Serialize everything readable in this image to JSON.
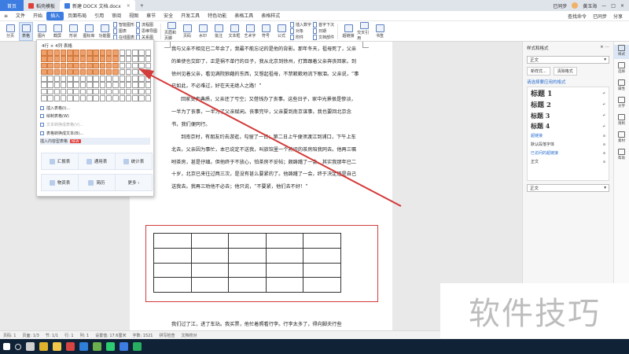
{
  "tabs": [
    {
      "label": "首页",
      "kind": "home"
    },
    {
      "label": "稻壳模板",
      "kind": "normal",
      "color": "#e0403a"
    },
    {
      "label": "新建 DOCX 文档.docx",
      "kind": "active",
      "color": "#3d7ce0"
    }
  ],
  "titlebar_right": {
    "login": "已同步",
    "user": "黄玉海"
  },
  "menu": [
    "文件",
    "开始",
    "插入",
    "页面布局",
    "引用",
    "审阅",
    "视图",
    "章节",
    "安全",
    "开发工具",
    "特色功能",
    "表格工具",
    "表格样式"
  ],
  "menu_active_index": 2,
  "menu_right": [
    "查找命令",
    "已同步",
    "分享"
  ],
  "ribbon": {
    "buttons": [
      "分页",
      "表格",
      "图片",
      "截屏",
      "形状",
      "图标库",
      "功能图"
    ],
    "col1": [
      "智能图形",
      "图表",
      "在线图表"
    ],
    "col2": [
      "流程图",
      "思维导图",
      "关系图"
    ],
    "buttons2": [
      "页眉和页脚",
      "页码",
      "水印",
      "批注",
      "文本框",
      "艺术字",
      "符号",
      "公式"
    ],
    "col3": [
      "插入数字",
      "对象",
      "附件"
    ],
    "col4": [
      "首字下沉",
      "日期",
      "文档部件"
    ],
    "buttons3": [
      "超链接",
      "交叉引用",
      "书签"
    ]
  },
  "dropdown": {
    "grid_label": "4行 × 4列 表格",
    "grid_rows": 8,
    "grid_cols": 17,
    "selected_rows": 4,
    "selected_cols": 12,
    "items": [
      {
        "label": "插入表格(I)...",
        "disabled": false
      },
      {
        "label": "绘制表格(W)",
        "disabled": false
      },
      {
        "label": "文本转换成表格(V)...",
        "disabled": true
      },
      {
        "label": "表格转换成文本(B)...",
        "disabled": false
      },
      {
        "label": "插入内容型表格",
        "disabled": false,
        "badge": "NEW"
      }
    ],
    "templates": [
      "汇报表",
      "通用表",
      "统计表",
      "物资表",
      "简历",
      "更多"
    ]
  },
  "document": {
    "paragraphs": [
      "我与父亲不相见已二年余了，我最不能忘记的是他的背影。那年冬天，祖母死了，父亲的差使也交卸了，正是祸不单行的日子，我从北京到徐州，打算跟着父亲奔丧回家。到徐州见着父亲，看见满院狼藉的东西，又想起祖母，不禁簌簌地流下眼泪。父亲说，“事已如此，不必难过，好在天无绝人之路！”",
      "回家变卖典质，父亲还了亏空；又借钱办了丧事。这些日子，家中光景很是惨淡，一半为了丧事，一半为了父亲赋闲。丧事完毕，父亲要到南京谋事，我也要回北京念书，我们便同行。",
      "到南京时，有朋友约去游逛，勾留了一日；第二日上午便须渡江到浦口，下午上车北去。父亲因为事忙，本已说定不送我，叫旅馆里一个熟识的茶房陪我同去。他再三嘱咐茶房，甚是仔细。但他终于不放心，怕茶房不妥帖；颇踌躇了一会。其实我那年已二十岁，北京已来往过两三次，是没有甚么要紧的了。他踌躇了一会，终于决定还是自己送我去。我再三劝他不必去；他只说，“不要紧，他们去不好！”"
    ],
    "bottom_text": "我们过了江，进了车站。我买票，他忙着照看行李。行李太多了，得向脚夫行些",
    "table": {
      "rows": 4,
      "cols": 5
    }
  },
  "style_panel": {
    "title": "样式和格式",
    "current": "正文",
    "new_style": "新样式...",
    "clear": "清除格式",
    "subtitle": "请选择要应用的格式",
    "styles": [
      {
        "label": "标题 1",
        "kind": "h1"
      },
      {
        "label": "标题 2",
        "kind": "h2"
      },
      {
        "label": "标题 3",
        "kind": "h3"
      },
      {
        "label": "标题 4",
        "kind": "h4"
      },
      {
        "label": "超链接",
        "kind": "link"
      },
      {
        "label": "默认段落字体",
        "kind": "small"
      },
      {
        "label": "已访问的超链接",
        "kind": "link"
      },
      {
        "label": "正文",
        "kind": "small"
      }
    ],
    "bottom_select": "正文"
  },
  "side_tools": [
    "样式",
    "选择",
    "属性",
    "文字",
    "限制",
    "素材",
    "帮助"
  ],
  "status": {
    "left": [
      "页码: 1",
      "页面: 1/3",
      "节: 1/1",
      "行: 1",
      "列: 1",
      "设置值: 17.6厘米",
      "字数: 1521",
      "拼写检查",
      "文档校对"
    ],
    "right": [
      "文档未保护"
    ]
  },
  "taskbar_icons": [
    {
      "name": "start",
      "color": "#ffffff"
    },
    {
      "name": "search",
      "color": "#ffffff"
    },
    {
      "name": "task-view",
      "color": "#d0d0d0"
    },
    {
      "name": "chrome",
      "color": "#e0b12c"
    },
    {
      "name": "explorer",
      "color": "#f3c74a"
    },
    {
      "name": "wps",
      "color": "#d64541"
    },
    {
      "name": "photoshop",
      "color": "#2f7ed8"
    },
    {
      "name": "app",
      "color": "#6ab04c"
    },
    {
      "name": "wechat",
      "color": "#2ecc71"
    },
    {
      "name": "wps-writer",
      "color": "#3d7ce0"
    },
    {
      "name": "app2",
      "color": "#27ae60"
    }
  ],
  "watermark": "软件技巧",
  "colors": {
    "accent": "#3d7ce0",
    "selection_red": "#d43b3b",
    "grid_orange": "#f0a06a"
  }
}
